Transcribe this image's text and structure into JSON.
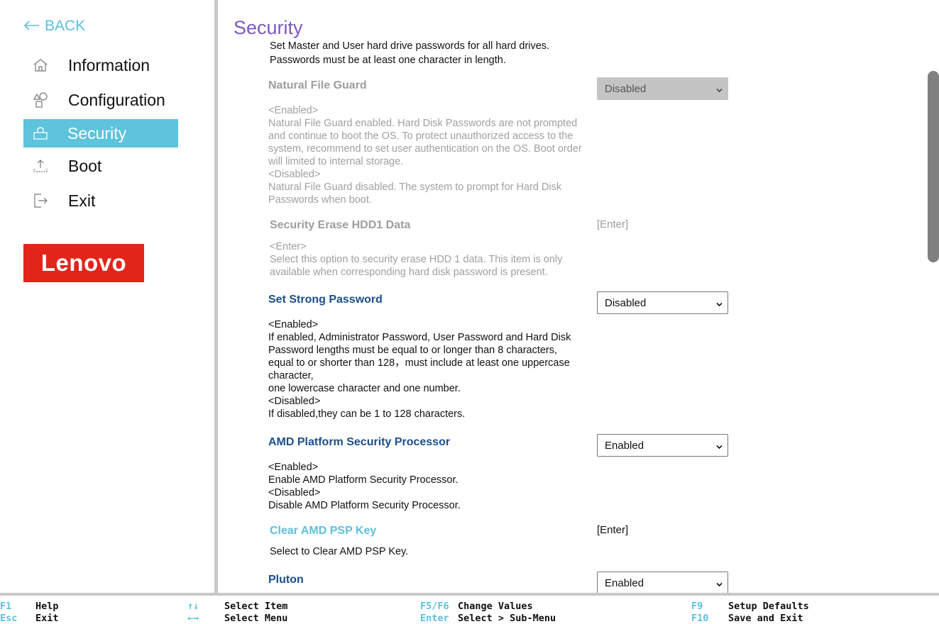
{
  "sidebar": {
    "back_label": "BACK",
    "items": [
      {
        "label": "Information",
        "icon": "home-icon"
      },
      {
        "label": "Configuration",
        "icon": "shapes-icon"
      },
      {
        "label": "Security",
        "icon": "lock-icon",
        "active": true
      },
      {
        "label": "Boot",
        "icon": "boot-upload-icon"
      },
      {
        "label": "Exit",
        "icon": "exit-icon"
      }
    ],
    "logo": "Lenovo"
  },
  "page": {
    "title": "Security",
    "partial_top_line1": "Set Master and User hard drive passwords for all hard drives.",
    "partial_top_line2": "Passwords must be at least one character in length."
  },
  "settings": {
    "natural_file_guard": {
      "label": "Natural File Guard",
      "value": "Disabled",
      "desc": "<Enabled>\nNatural File Guard enabled. Hard Disk Passwords are not prompted\nand continue to boot the OS. To protect unauthorized access to the\nsystem, recommend to set user authentication on the OS. Boot order\nwill limited to internal storage.\n<Disabled>\nNatural File Guard disabled. The system to prompt for Hard Disk\nPasswords when boot."
    },
    "security_erase": {
      "label": "Security Erase HDD1 Data",
      "value": "[Enter]",
      "desc": "<Enter>\nSelect this option to security erase HDD 1 data. This item is only\navailable when corresponding hard disk password is present."
    },
    "strong_password": {
      "label": "Set Strong Password",
      "value": "Disabled",
      "desc": "<Enabled>\nIf enabled, Administrator Password, User Password and Hard Disk\nPassword lengths must be equal to or longer than 8 characters,\nequal to or shorter than 128，must include at least one uppercase\ncharacter,\none lowercase character and one number.\n<Disabled>\nIf disabled,they can be 1 to 128 characters."
    },
    "amd_psp": {
      "label": "AMD Platform Security Processor",
      "value": "Enabled",
      "desc": "<Enabled>\nEnable AMD Platform Security Processor.\n<Disabled>\nDisable AMD Platform Security Processor."
    },
    "clear_psp_key": {
      "label": "Clear AMD PSP Key",
      "value": "[Enter]",
      "desc": "Select to Clear AMD PSP Key."
    },
    "pluton": {
      "label": "Pluton",
      "value": "Enabled"
    }
  },
  "footer": {
    "f1_key": "F1",
    "f1_label": "Help",
    "esc_key": "Esc",
    "esc_label": "Exit",
    "updown_key": "↑↓",
    "updown_label": "Select Item",
    "leftright_key": "←→",
    "leftright_label": "Select Menu",
    "f5f6_key": "F5/F6",
    "f5f6_label": "Change Values",
    "enter_key": "Enter",
    "enter_label": "Select > Sub-Menu",
    "f9_key": "F9",
    "f9_label": "Setup Defaults",
    "f10_key": "F10",
    "f10_label": "Save and Exit"
  },
  "colors": {
    "accent": "#5bc0de",
    "active_bg": "#5ec3dc",
    "title": "#7e57c2",
    "setting_label": "#1b4f8a",
    "logo_bg": "#e1251b"
  }
}
